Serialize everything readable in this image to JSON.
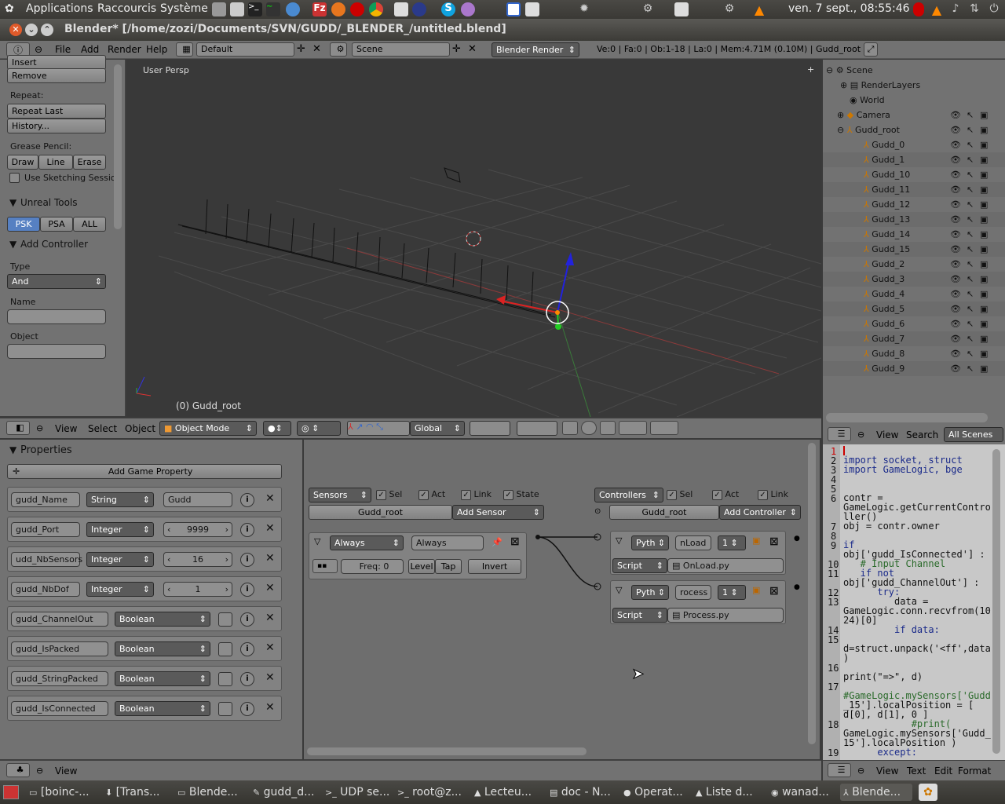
{
  "sysbar": {
    "applications": "Applications",
    "raccourcis": "Raccourcis",
    "systeme": "Système",
    "clock": "ven.  7 sept., 08:55:46"
  },
  "window": {
    "title": "Blender* [/home/zozi/Documents/SVN/GUDD/_BLENDER_/untitled.blend]"
  },
  "infobar": {
    "menu": [
      "File",
      "Add",
      "Render",
      "Help"
    ],
    "layout": "Default",
    "scene": "Scene",
    "engine": "Blender Render",
    "stats": "Ve:0 | Fa:0 | Ob:1-18 | La:0 | Mem:4.71M (0.10M) | Gudd_root"
  },
  "toolshelf": {
    "insert": "Insert",
    "remove": "Remove",
    "repeat": "Repeat:",
    "repeat_last": "Repeat Last",
    "history": "History...",
    "grease": "Grease Pencil:",
    "draw": "Draw",
    "line": "Line",
    "erase": "Erase",
    "sketch": "Use Sketching Sessio",
    "unreal": "Unreal Tools",
    "psk": "PSK",
    "psa": "PSA",
    "all": "ALL",
    "add_ctrl": "Add Controller",
    "type_lbl": "Type",
    "type_val": "And",
    "name_lbl": "Name",
    "object_lbl": "Object"
  },
  "viewport": {
    "persp": "User Persp",
    "object": "(0) Gudd_root"
  },
  "vpheader": {
    "view": "View",
    "select": "Select",
    "object": "Object",
    "mode": "Object Mode",
    "orient": "Global"
  },
  "outliner": {
    "scene": "Scene",
    "renderlayers": "RenderLayers",
    "world": "World",
    "camera": "Camera",
    "root": "Gudd_root",
    "children": [
      "Gudd_0",
      "Gudd_1",
      "Gudd_10",
      "Gudd_11",
      "Gudd_12",
      "Gudd_13",
      "Gudd_14",
      "Gudd_15",
      "Gudd_2",
      "Gudd_3",
      "Gudd_4",
      "Gudd_5",
      "Gudd_6",
      "Gudd_7",
      "Gudd_8",
      "Gudd_9"
    ]
  },
  "texthdr": {
    "view": "View",
    "search": "Search",
    "filter": "All Scenes"
  },
  "props": {
    "title": "Properties",
    "add": "Add Game Property",
    "rows": [
      {
        "name": "gudd_Name",
        "type": "String",
        "value": "Gudd"
      },
      {
        "name": "gudd_Port",
        "type": "Integer",
        "value": "9999"
      },
      {
        "name": "udd_NbSensors",
        "type": "Integer",
        "value": "16"
      },
      {
        "name": "gudd_NbDof",
        "type": "Integer",
        "value": "1"
      },
      {
        "name": "gudd_ChannelOut",
        "type": "Boolean",
        "value": ""
      },
      {
        "name": "gudd_IsPacked",
        "type": "Boolean",
        "value": ""
      },
      {
        "name": "gudd_StringPacked",
        "type": "Boolean",
        "value": ""
      },
      {
        "name": "gudd_IsConnected",
        "type": "Boolean",
        "value": ""
      }
    ]
  },
  "logic": {
    "sensors": "Sensors",
    "controllers": "Controllers",
    "sel": "Sel",
    "act": "Act",
    "link": "Link",
    "state": "State",
    "obj": "Gudd_root",
    "add_sensor": "Add Sensor",
    "add_controller": "Add Controller",
    "sensor": {
      "type": "Always",
      "name": "Always",
      "freq": "Freq: 0",
      "level": "Level",
      "tap": "Tap",
      "invert": "Invert"
    },
    "ctrl1": {
      "type": "Pyth",
      "name": "nLoad",
      "num": "1",
      "mode": "Script",
      "file": "OnLoad.py"
    },
    "ctrl2": {
      "type": "Pyth",
      "name": "rocess",
      "num": "1",
      "mode": "Script",
      "file": "Process.py"
    }
  },
  "code": {
    "lines": [
      {
        "n": "1",
        "t": ""
      },
      {
        "n": "2",
        "t": "import socket, struct"
      },
      {
        "n": "3",
        "t": "import GameLogic, bge"
      },
      {
        "n": "4",
        "t": ""
      },
      {
        "n": "5",
        "t": ""
      },
      {
        "n": "6",
        "t": "contr ="
      },
      {
        "n": "",
        "t": "GameLogic.getCurrentContro"
      },
      {
        "n": "",
        "t": "ller()"
      },
      {
        "n": "7",
        "t": "obj = contr.owner"
      },
      {
        "n": "8",
        "t": ""
      },
      {
        "n": "9",
        "t": "if"
      },
      {
        "n": "",
        "t": "obj['gudd_IsConnected'] :"
      },
      {
        "n": "10",
        "t": "   # Input Channel"
      },
      {
        "n": "11",
        "t": "   if not"
      },
      {
        "n": "",
        "t": "obj['gudd_ChannelOut'] :"
      },
      {
        "n": "12",
        "t": "      try:"
      },
      {
        "n": "13",
        "t": "         data ="
      },
      {
        "n": "",
        "t": "GameLogic.conn.recvfrom(10"
      },
      {
        "n": "",
        "t": "24)[0]"
      },
      {
        "n": "14",
        "t": "         if data:"
      },
      {
        "n": "15",
        "t": ""
      },
      {
        "n": "",
        "t": "d=struct.unpack('<ff',data"
      },
      {
        "n": "",
        "t": ")"
      },
      {
        "n": "16",
        "t": ""
      },
      {
        "n": "",
        "t": "print(\"=>\", d)"
      },
      {
        "n": "17",
        "t": ""
      },
      {
        "n": "",
        "t": "#GameLogic.mySensors['Gudd"
      },
      {
        "n": "",
        "t": "_15'].localPosition = ["
      },
      {
        "n": "",
        "t": "d[0], d[1], 0 ]"
      },
      {
        "n": "18",
        "t": "            #print("
      },
      {
        "n": "",
        "t": "GameLogic.mySensors['Gudd_"
      },
      {
        "n": "",
        "t": "15'].localPosition )"
      },
      {
        "n": "19",
        "t": "      except:"
      }
    ]
  },
  "btmbar": {
    "view": "View"
  },
  "btmbar2": {
    "view": "View",
    "text": "Text",
    "edit": "Edit",
    "format": "Format"
  },
  "taskbar": {
    "tasks": [
      "[boinc-...",
      "[Trans...",
      "Blende...",
      "gudd_d...",
      "UDP se...",
      "root@z...",
      "Lecteu...",
      "doc - N...",
      "Operat...",
      "Liste d...",
      "wanad...",
      "Blende..."
    ]
  }
}
